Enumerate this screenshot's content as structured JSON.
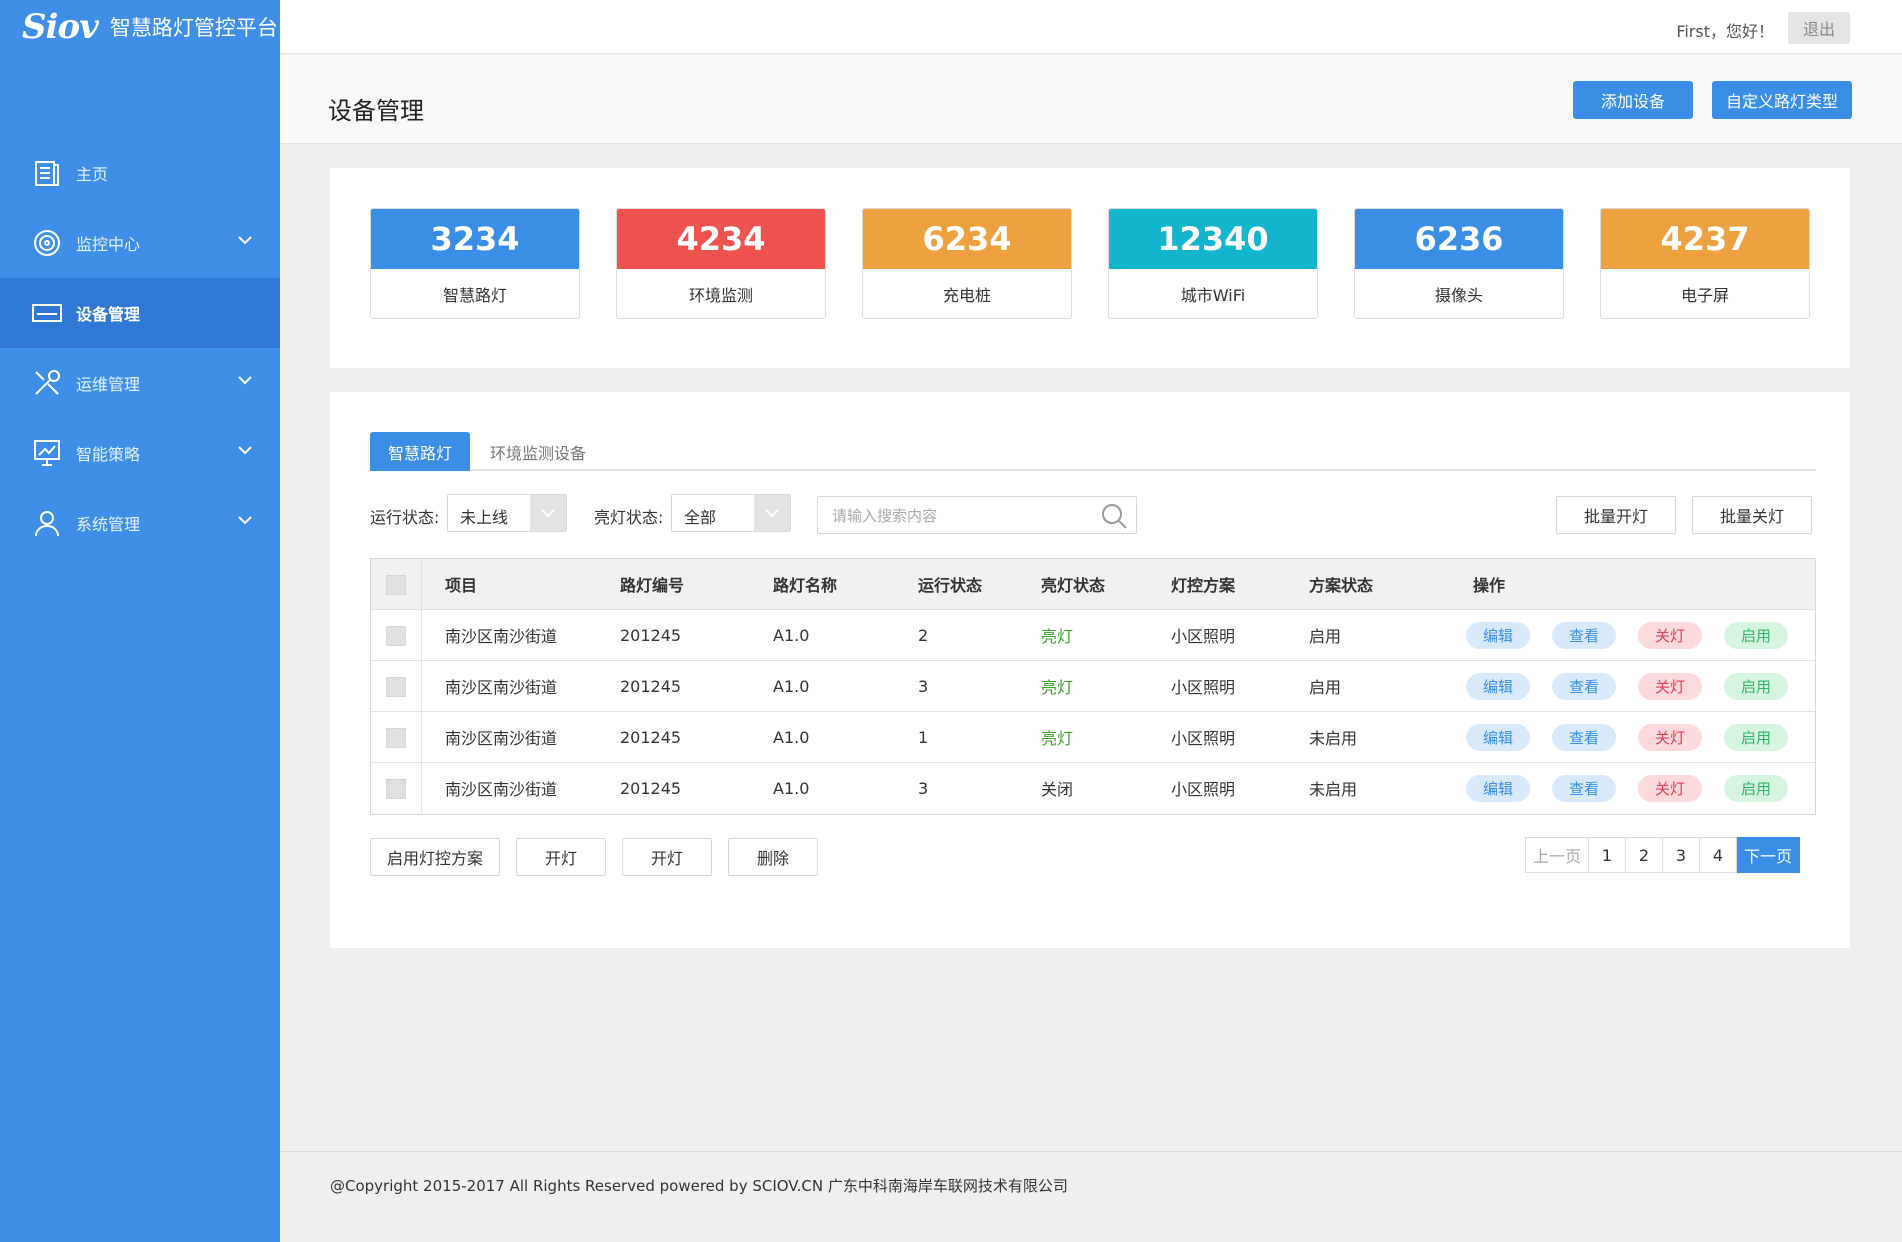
{
  "brand": {
    "logo_mark": "Siov",
    "app_title": "智慧路灯管控平台"
  },
  "topbar": {
    "greeting": "First，您好！",
    "logout_label": "退出"
  },
  "sidebar": {
    "items": [
      {
        "label": "主页",
        "icon": "document-icon"
      },
      {
        "label": "监控中心",
        "icon": "target-icon",
        "expandable": true
      },
      {
        "label": "设备管理",
        "icon": "device-icon",
        "active": true
      },
      {
        "label": "运维管理",
        "icon": "tools-icon",
        "expandable": true
      },
      {
        "label": "智能策略",
        "icon": "chart-monitor-icon",
        "expandable": true
      },
      {
        "label": "系统管理",
        "icon": "user-icon",
        "expandable": true
      }
    ]
  },
  "page": {
    "title": "设备管理",
    "add_device_label": "添加设备",
    "custom_type_label": "自定义路灯类型"
  },
  "stats": [
    {
      "value": "3234",
      "label": "智慧路灯",
      "color": "#3a8ee6"
    },
    {
      "value": "4234",
      "label": "环境监测",
      "color": "#ef5350"
    },
    {
      "value": "6234",
      "label": "充电桩",
      "color": "#eea140"
    },
    {
      "value": "12340",
      "label": "城市WiFi",
      "color": "#12b5cb"
    },
    {
      "value": "6236",
      "label": "摄像头",
      "color": "#3a8ee6"
    },
    {
      "value": "4237",
      "label": "电子屏",
      "color": "#eea140"
    }
  ],
  "tabs": [
    {
      "label": "智慧路灯"
    },
    {
      "label": "环境监测设备"
    }
  ],
  "filters": {
    "run_status_label": "运行状态:",
    "run_status_value": "未上线",
    "light_status_label": "亮灯状态:",
    "light_status_value": "全部",
    "search_placeholder": "请输入搜索内容",
    "batch_on_label": "批量开灯",
    "batch_off_label": "批量关灯"
  },
  "table": {
    "columns": [
      "项目",
      "路灯编号",
      "路灯名称",
      "运行状态",
      "亮灯状态",
      "灯控方案",
      "方案状态",
      "操作"
    ],
    "actions": {
      "edit": "编辑",
      "view": "查看",
      "off": "关灯",
      "on": "启用"
    },
    "rows": [
      {
        "project": "南沙区南沙街道",
        "lamp_no": "201245",
        "lamp_name": "A1.0",
        "run_status": "2",
        "light_status": "亮灯",
        "light_on": true,
        "scheme": "小区照明",
        "scheme_status": "启用"
      },
      {
        "project": "南沙区南沙街道",
        "lamp_no": "201245",
        "lamp_name": "A1.0",
        "run_status": "3",
        "light_status": "亮灯",
        "light_on": true,
        "scheme": "小区照明",
        "scheme_status": "启用"
      },
      {
        "project": "南沙区南沙街道",
        "lamp_no": "201245",
        "lamp_name": "A1.0",
        "run_status": "1",
        "light_status": "亮灯",
        "light_on": true,
        "scheme": "小区照明",
        "scheme_status": "未启用"
      },
      {
        "project": "南沙区南沙街道",
        "lamp_no": "201245",
        "lamp_name": "A1.0",
        "run_status": "3",
        "light_status": "关闭",
        "light_on": false,
        "scheme": "小区照明",
        "scheme_status": "未启用"
      }
    ]
  },
  "bottom_actions": {
    "enable_scheme": "启用灯控方案",
    "light_on_1": "开灯",
    "light_on_2": "开灯",
    "delete": "删除"
  },
  "pagination": {
    "prev": "上一页",
    "pages": [
      "1",
      "2",
      "3",
      "4"
    ],
    "next": "下一页"
  },
  "footer": {
    "copyright": "@Copyright 2015-2017 All Rights Reserved powered by SCIOV.CN 广东中科南海岸车联网技术有限公司"
  }
}
